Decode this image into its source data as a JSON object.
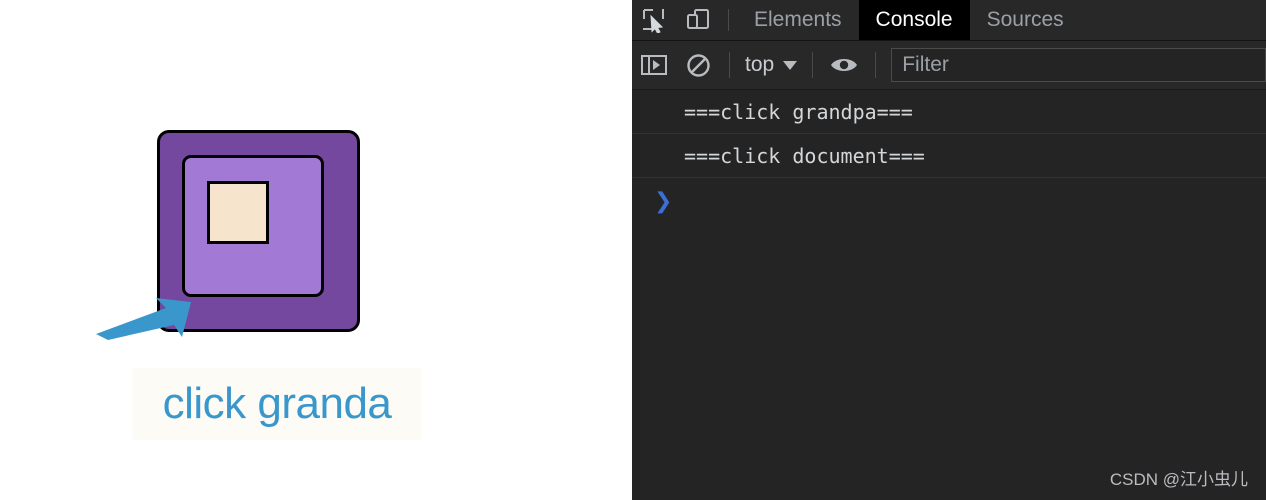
{
  "page": {
    "boxes": {
      "grandpa": {
        "name": "grandpa",
        "color": "#74489E"
      },
      "parent": {
        "name": "parent",
        "color": "#A379D6"
      },
      "child": {
        "name": "child",
        "color": "#F7E4CC"
      }
    },
    "annotation": {
      "arrow_icon": "arrow-pointer-icon",
      "arrow_color": "#3A97CC",
      "label": "click granda",
      "label_color": "#3A97CC"
    }
  },
  "devtools": {
    "tabbar": {
      "inspect_icon": "inspect-element-icon",
      "device_icon": "device-toolbar-icon",
      "tabs": [
        {
          "label": "Elements",
          "active": false
        },
        {
          "label": "Console",
          "active": true
        },
        {
          "label": "Sources",
          "active": false
        }
      ]
    },
    "filterbar": {
      "sidebar_icon": "console-sidebar-icon",
      "clear_icon": "clear-console-icon",
      "context": "top",
      "context_caret_icon": "chevron-down-icon",
      "eye_icon": "live-expression-eye-icon",
      "filter_placeholder": "Filter"
    },
    "console": {
      "messages": [
        "===click grandpa===",
        "===click document==="
      ],
      "prompt_icon": "prompt-chevron-icon",
      "prompt_glyph": "❯"
    },
    "watermark": "CSDN @江小虫儿"
  }
}
